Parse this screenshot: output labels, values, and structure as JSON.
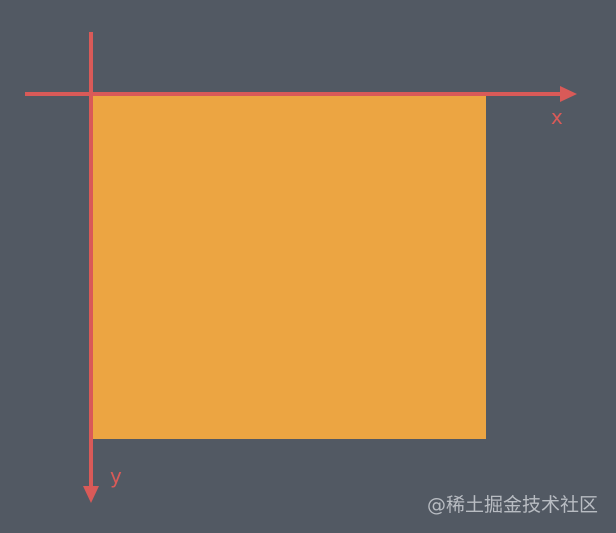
{
  "diagram": {
    "x_axis_label": "x",
    "y_axis_label": "y"
  },
  "watermark": {
    "text": "@稀土掘金技术社区"
  },
  "colors": {
    "background": "#525963",
    "rectangle_fill": "#eca542",
    "axis": "#d95a58",
    "watermark": "#b8bcc2"
  }
}
